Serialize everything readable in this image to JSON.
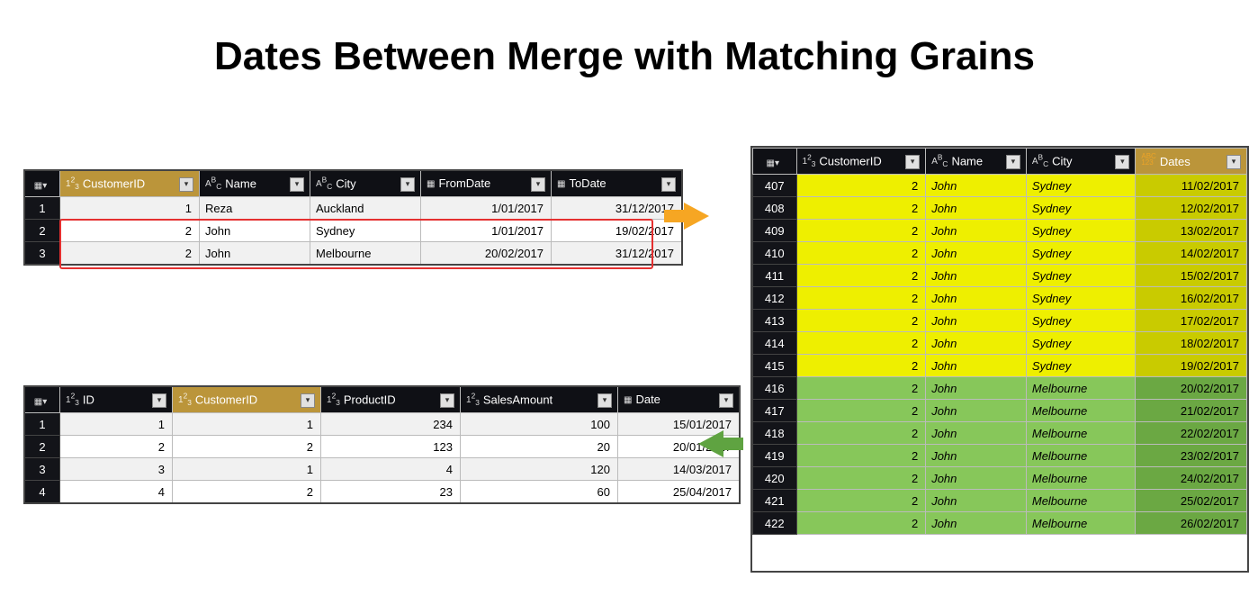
{
  "title": "Dates Between Merge with Matching Grains",
  "cols1": [
    "CustomerID",
    "Name",
    "City",
    "FromDate",
    "ToDate"
  ],
  "types1": [
    "n",
    "t",
    "t",
    "d",
    "d"
  ],
  "t1": [
    [
      "1",
      "1",
      "Reza",
      "Auckland",
      "1/01/2017",
      "31/12/2017"
    ],
    [
      "2",
      "2",
      "John",
      "Sydney",
      "1/01/2017",
      "19/02/2017"
    ],
    [
      "3",
      "2",
      "John",
      "Melbourne",
      "20/02/2017",
      "31/12/2017"
    ]
  ],
  "cols2": [
    "ID",
    "CustomerID",
    "ProductID",
    "SalesAmount",
    "Date"
  ],
  "types2": [
    "n",
    "n",
    "n",
    "n",
    "d"
  ],
  "t2": [
    [
      "1",
      "1",
      "1",
      "234",
      "100",
      "15/01/2017"
    ],
    [
      "2",
      "2",
      "2",
      "123",
      "20",
      "20/01/2017"
    ],
    [
      "3",
      "3",
      "1",
      "4",
      "120",
      "14/03/2017"
    ],
    [
      "4",
      "4",
      "2",
      "23",
      "60",
      "25/04/2017"
    ]
  ],
  "cols3": [
    "CustomerID",
    "Name",
    "City",
    "Dates"
  ],
  "types3": [
    "n",
    "t",
    "t",
    "a"
  ],
  "t3": [
    [
      "407",
      "2",
      "John",
      "Sydney",
      "11/02/2017",
      "y"
    ],
    [
      "408",
      "2",
      "John",
      "Sydney",
      "12/02/2017",
      "y"
    ],
    [
      "409",
      "2",
      "John",
      "Sydney",
      "13/02/2017",
      "y"
    ],
    [
      "410",
      "2",
      "John",
      "Sydney",
      "14/02/2017",
      "y"
    ],
    [
      "411",
      "2",
      "John",
      "Sydney",
      "15/02/2017",
      "y"
    ],
    [
      "412",
      "2",
      "John",
      "Sydney",
      "16/02/2017",
      "y"
    ],
    [
      "413",
      "2",
      "John",
      "Sydney",
      "17/02/2017",
      "y"
    ],
    [
      "414",
      "2",
      "John",
      "Sydney",
      "18/02/2017",
      "y"
    ],
    [
      "415",
      "2",
      "John",
      "Sydney",
      "19/02/2017",
      "y"
    ],
    [
      "416",
      "2",
      "John",
      "Melbourne",
      "20/02/2017",
      "g"
    ],
    [
      "417",
      "2",
      "John",
      "Melbourne",
      "21/02/2017",
      "g"
    ],
    [
      "418",
      "2",
      "John",
      "Melbourne",
      "22/02/2017",
      "g"
    ],
    [
      "419",
      "2",
      "John",
      "Melbourne",
      "23/02/2017",
      "g"
    ],
    [
      "420",
      "2",
      "John",
      "Melbourne",
      "24/02/2017",
      "g"
    ],
    [
      "421",
      "2",
      "John",
      "Melbourne",
      "25/02/2017",
      "g"
    ],
    [
      "422",
      "2",
      "John",
      "Melbourne",
      "26/02/2017",
      "g"
    ]
  ],
  "typeIcon": {
    "n": "1²₃",
    "t": "AᴮC",
    "d": "▦",
    "a": "ABC\n123"
  }
}
